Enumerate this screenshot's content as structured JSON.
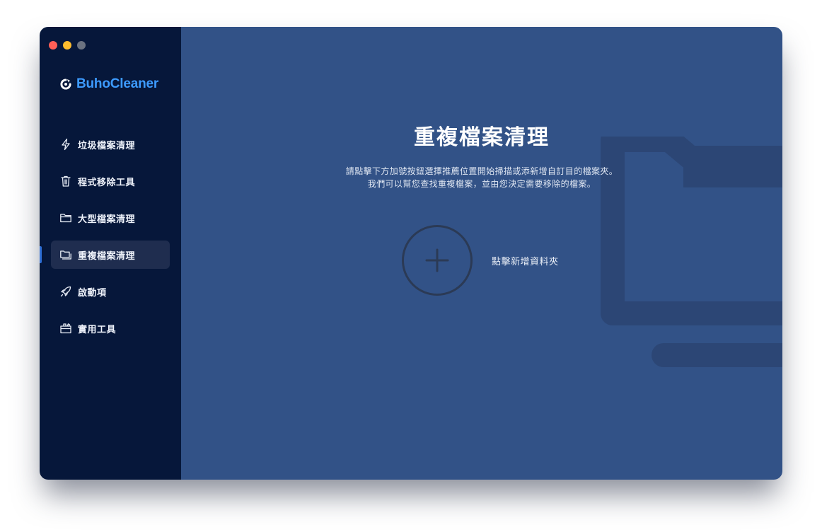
{
  "app": {
    "name": "BuhoCleaner"
  },
  "window_controls": [
    {
      "name": "close",
      "color": "#ff5f57"
    },
    {
      "name": "minimize",
      "color": "#febc2e"
    },
    {
      "name": "zoom",
      "color": "#6b7280"
    }
  ],
  "sidebar": {
    "items": [
      {
        "label": "垃圾檔案清理",
        "icon": "lightning-icon",
        "active": false
      },
      {
        "label": "程式移除工具",
        "icon": "trash-icon",
        "active": false
      },
      {
        "label": "大型檔案清理",
        "icon": "folder-icon",
        "active": false
      },
      {
        "label": "重複檔案清理",
        "icon": "duplicate-folder-icon",
        "active": true
      },
      {
        "label": "啟動項",
        "icon": "rocket-icon",
        "active": false
      },
      {
        "label": "實用工具",
        "icon": "toolbox-icon",
        "active": false
      }
    ]
  },
  "main": {
    "title": "重複檔案清理",
    "description_line1": "請點擊下方加號按鈕選擇推薦位置開始掃描或添新增自訂目的檔案夾。",
    "description_line2": "我們可以幫您查找重複檔案，並由您決定需要移除的檔案。",
    "add_folder_label": "點擊新增資料夾"
  },
  "colors": {
    "sidebar_bg": "#06173a",
    "main_bg": "#325287",
    "accent": "#3d9bff",
    "active_item_bg": "#1f2d4f"
  }
}
